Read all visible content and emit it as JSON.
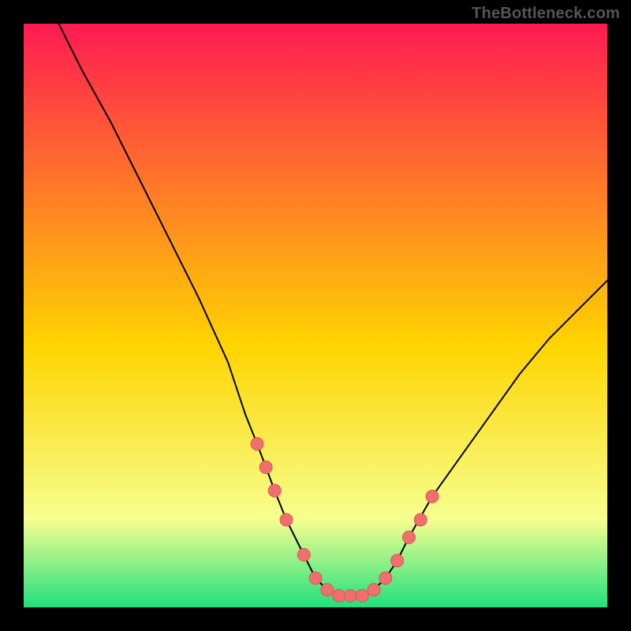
{
  "watermark": "TheBottleneck.com",
  "colors": {
    "gradient_top": "#ff1a52",
    "gradient_mid": "#ffd400",
    "gradient_low": "#f6ff90",
    "gradient_green": "#20e07e",
    "curve_stroke": "#000000",
    "marker_fill": "#ef6f6f",
    "marker_stroke": "#e05656",
    "background": "#000000"
  },
  "chart_data": {
    "type": "line",
    "title": "",
    "xlabel": "",
    "ylabel": "",
    "xlim": [
      0,
      100
    ],
    "ylim": [
      0,
      100
    ],
    "legend": false,
    "grid": false,
    "comment": "V-shaped bottleneck curve over a vertical red-to-green gradient. Values are estimated from the plot in percent-of-axis units.",
    "series": [
      {
        "name": "bottleneck-curve",
        "x": [
          6,
          10,
          15,
          20,
          25,
          30,
          35,
          38,
          40,
          43,
          45,
          48,
          50,
          52,
          54,
          56,
          58,
          60,
          62,
          64,
          66,
          70,
          75,
          80,
          85,
          90,
          95,
          100
        ],
        "y": [
          100,
          92,
          83,
          73,
          63,
          53,
          42,
          33,
          28,
          20,
          15,
          9,
          5,
          3,
          2,
          2,
          2,
          3,
          5,
          8,
          12,
          19,
          26,
          33,
          40,
          46,
          51,
          56
        ]
      }
    ],
    "markers": {
      "name": "highlight-points",
      "x": [
        40,
        41.5,
        43,
        45,
        48,
        50,
        52,
        54,
        56,
        58,
        60,
        62,
        64,
        66,
        68,
        70
      ],
      "y": [
        28,
        24,
        20,
        15,
        9,
        5,
        3,
        2,
        2,
        2,
        3,
        5,
        8,
        12,
        15,
        19
      ]
    }
  }
}
